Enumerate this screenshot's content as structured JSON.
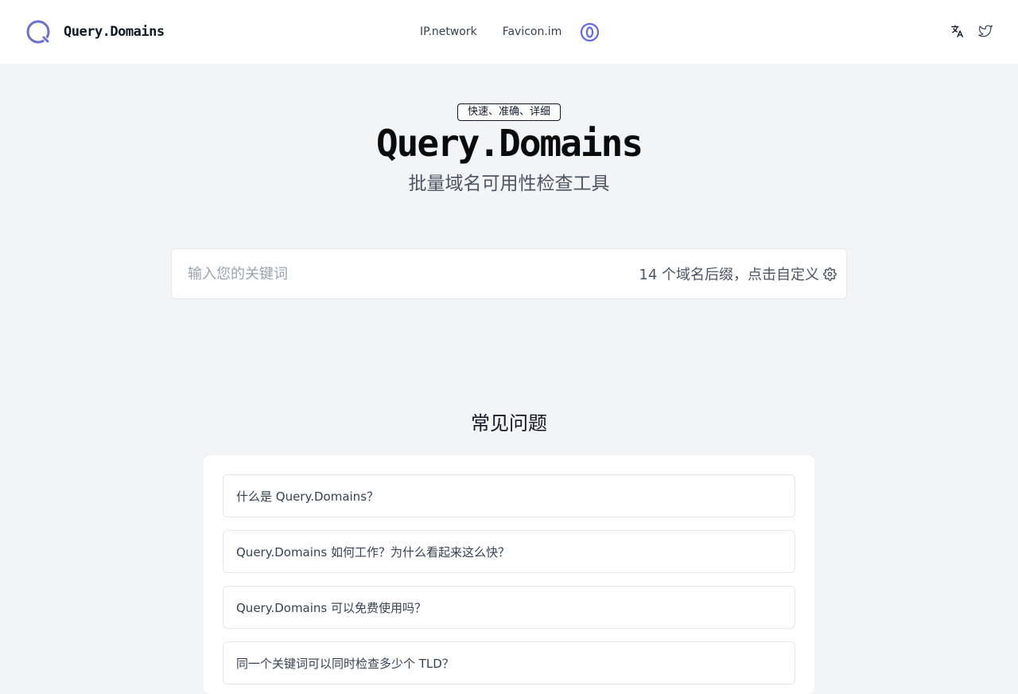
{
  "header": {
    "brand_name": "Query.Domains",
    "nav": [
      {
        "label": "IP.network"
      },
      {
        "label": "Favicon.im"
      }
    ]
  },
  "hero": {
    "badge": "快速、准确、详细",
    "title": "Query.Domains",
    "subtitle": "批量域名可用性检查工具"
  },
  "search": {
    "placeholder": "输入您的关键词",
    "value": "",
    "tld_label": "14 个域名后缀，点击自定义"
  },
  "faq": {
    "title": "常见问题",
    "items": [
      {
        "question": "什么是 Query.Domains？"
      },
      {
        "question": "Query.Domains 如何工作？为什么看起来这么快？"
      },
      {
        "question": "Query.Domains 可以免费使用吗？"
      },
      {
        "question": "同一个关键词可以同时检查多少个 TLD？"
      }
    ]
  },
  "icons": {
    "logo": "q-ring-logo-icon",
    "badge": "zero-circle-icon",
    "translate": "translate-icon",
    "twitter": "twitter-icon",
    "settings": "gear-icon"
  },
  "colors": {
    "accent": "#6366f1",
    "background": "#f3f4f6",
    "surface": "#ffffff"
  }
}
